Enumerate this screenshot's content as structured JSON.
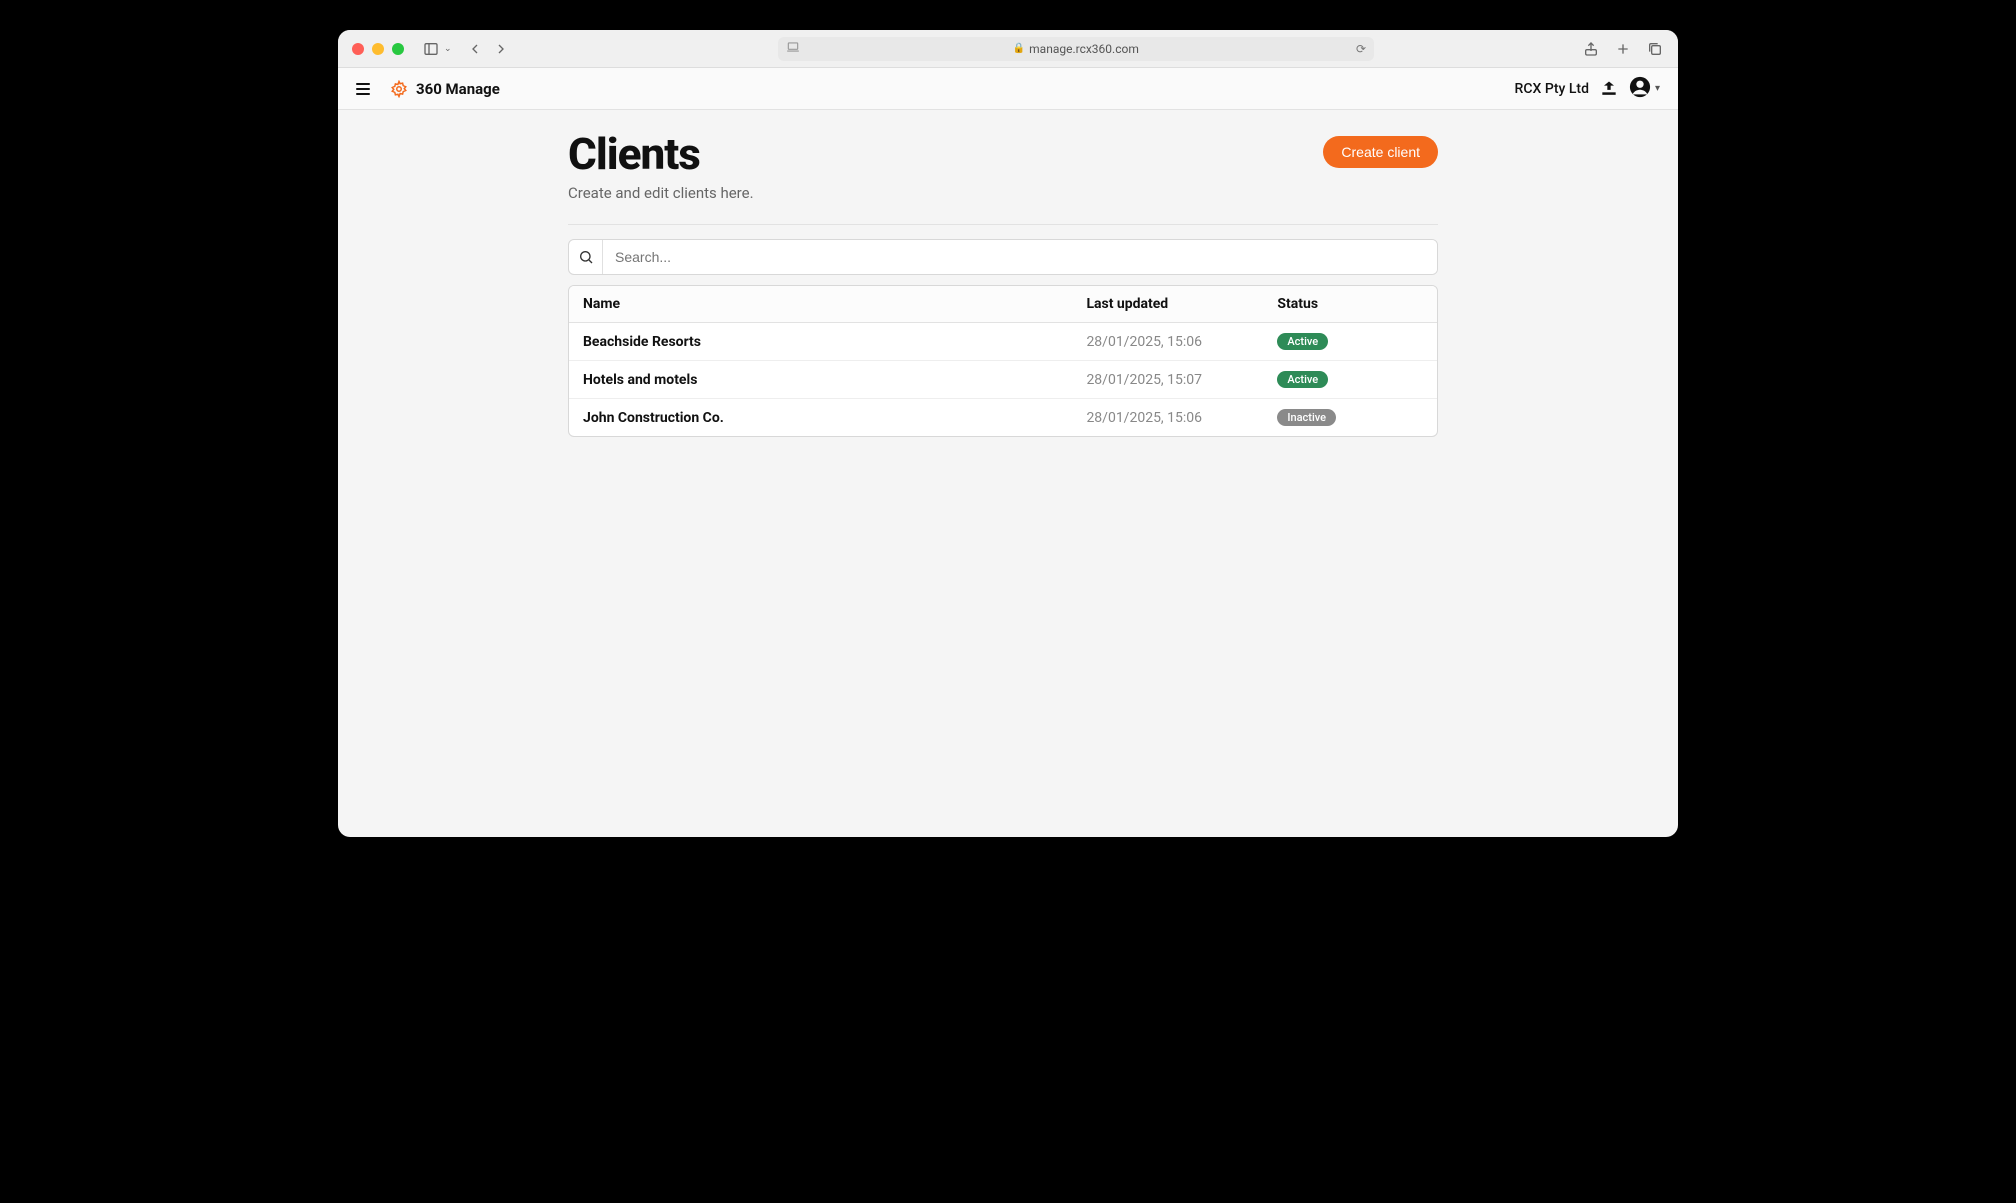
{
  "browser": {
    "url": "manage.rcx360.com"
  },
  "app": {
    "brand": "360 Manage",
    "company": "RCX Pty Ltd"
  },
  "page": {
    "title": "Clients",
    "subtitle": "Create and edit clients here.",
    "create_button": "Create client"
  },
  "search": {
    "placeholder": "Search..."
  },
  "table": {
    "columns": {
      "name": "Name",
      "last_updated": "Last updated",
      "status": "Status"
    },
    "rows": [
      {
        "name": "Beachside Resorts",
        "last_updated": "28/01/2025, 15:06",
        "status": "Active",
        "status_class": "badge-active"
      },
      {
        "name": "Hotels and motels",
        "last_updated": "28/01/2025, 15:07",
        "status": "Active",
        "status_class": "badge-active"
      },
      {
        "name": "John Construction Co.",
        "last_updated": "28/01/2025, 15:06",
        "status": "Inactive",
        "status_class": "badge-inactive"
      }
    ]
  }
}
